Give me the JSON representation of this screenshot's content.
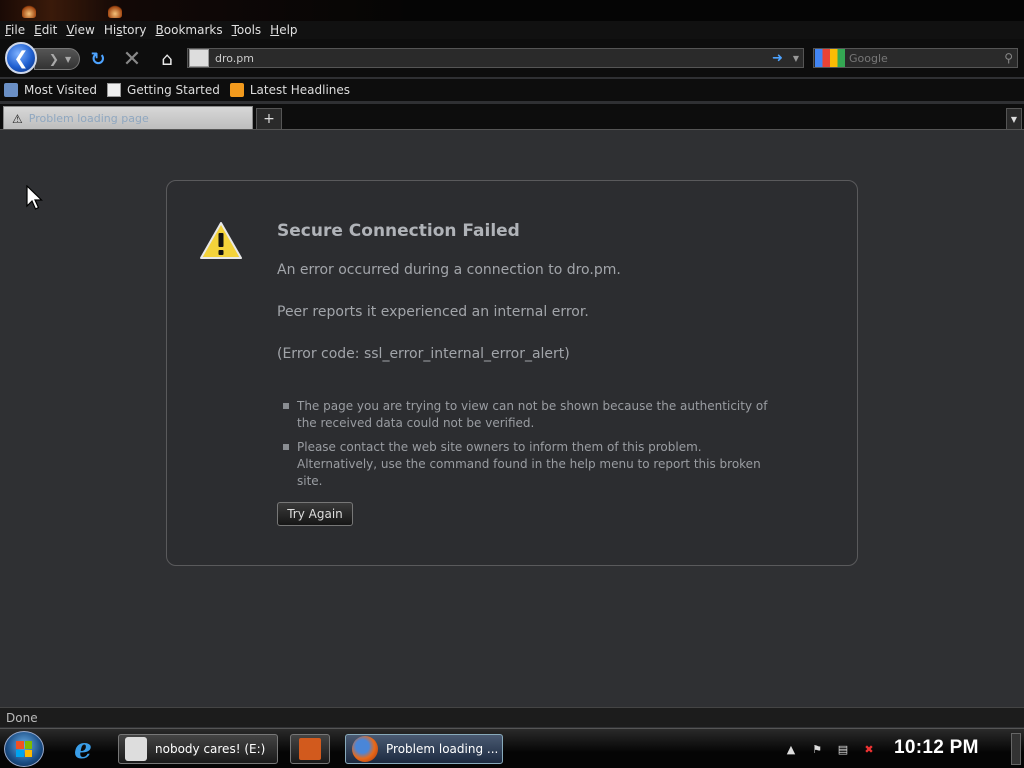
{
  "menu": {
    "file": {
      "pre": "",
      "key": "F",
      "post": "ile"
    },
    "edit": {
      "pre": "",
      "key": "E",
      "post": "dit"
    },
    "view": {
      "pre": "",
      "key": "V",
      "post": "iew"
    },
    "history": {
      "pre": "Hi",
      "key": "s",
      "post": "tory"
    },
    "bookmarks": {
      "pre": "",
      "key": "B",
      "post": "ookmarks"
    },
    "tools": {
      "pre": "",
      "key": "T",
      "post": "ools"
    },
    "help": {
      "pre": "",
      "key": "H",
      "post": "elp"
    }
  },
  "nav": {
    "url": "dro.pm",
    "search_placeholder": "Google"
  },
  "bookmarks": [
    "Most Visited",
    "Getting Started",
    "Latest Headlines"
  ],
  "tab": {
    "label": "Problem loading page"
  },
  "error": {
    "title": "Secure Connection Failed",
    "line1": "An error occurred during a connection to dro.pm.",
    "line2": "Peer reports it experienced an internal error.",
    "line3": "(Error code: ssl_error_internal_error_alert)",
    "bullets": [
      "The page you are trying to view can not be shown because the authenticity of the received data could not be verified.",
      "Please contact the web site owners to inform them of this problem. Alternatively, use the command found in the help menu to report this broken site."
    ],
    "button": "Try Again"
  },
  "status": "Done",
  "taskbar": {
    "usb_task": "nobody cares! (E:)",
    "firefox_task": "Problem loading ...",
    "clock": "10:12 PM"
  },
  "icons": {
    "back": "back-arrow-icon",
    "forward": "forward-arrow-icon",
    "reload": "reload-icon",
    "stop": "stop-icon",
    "home": "home-icon",
    "warning": "warning-icon"
  },
  "colors": {
    "background": "#2f3033",
    "accent": "#4da3ff",
    "warning_fill": "#f3d23a"
  }
}
